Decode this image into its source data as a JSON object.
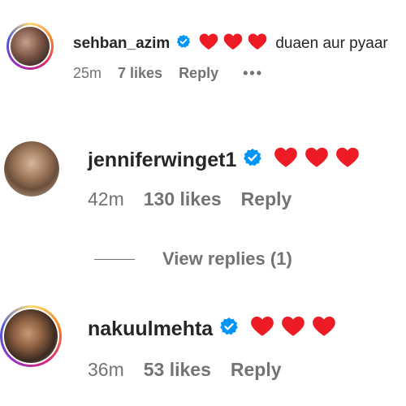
{
  "comments": [
    {
      "username": "sehban_azim",
      "text": "duaen aur pyaar",
      "time": "25m",
      "likes": "7 likes",
      "reply": "Reply",
      "more": "•••"
    },
    {
      "username": "jenniferwinget1",
      "text": "",
      "time": "42m",
      "likes": "130 likes",
      "reply": "Reply",
      "view_replies": "View replies (1)"
    },
    {
      "username": "nakuulmehta",
      "text": "",
      "time": "36m",
      "likes": "53 likes",
      "reply": "Reply"
    }
  ],
  "colors": {
    "verified": "#0095f6",
    "heart": "#ed1c24",
    "meta": "#737373",
    "text": "#262626"
  },
  "icons": [
    "verified-badge-icon",
    "heart-icon",
    "more-options-icon"
  ]
}
